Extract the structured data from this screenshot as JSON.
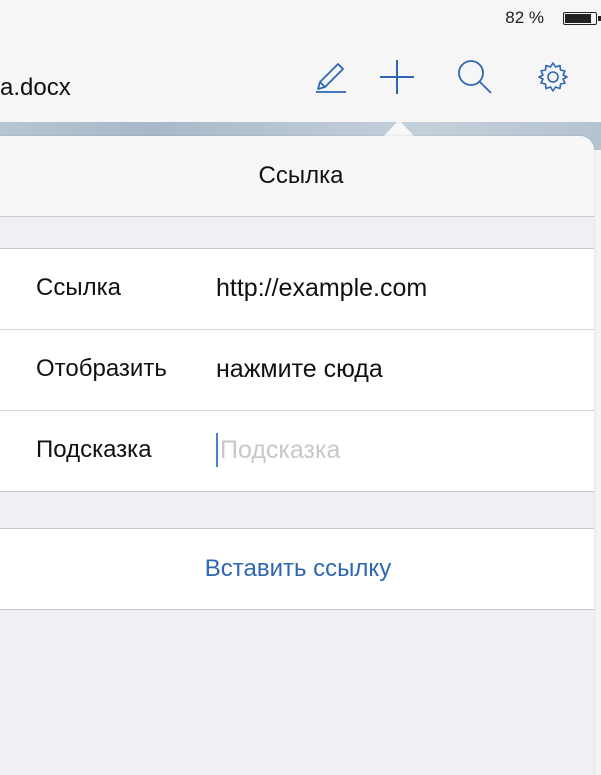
{
  "status_bar": {
    "battery_percent": "82 %",
    "battery_level": 0.82
  },
  "nav": {
    "document_title": "a.docx",
    "tools": [
      "edit-icon",
      "plus-icon",
      "search-icon",
      "gear-icon"
    ],
    "accent": "#2f66b3"
  },
  "popover": {
    "title": "Ссылка",
    "rows": [
      {
        "label": "Ссылка",
        "value": "http://example.com"
      },
      {
        "label": "Отобразить",
        "value": "нажмите сюда"
      },
      {
        "label": "Подсказка",
        "value": "",
        "placeholder": "Подсказка"
      }
    ],
    "action_label": "Вставить ссылку"
  }
}
